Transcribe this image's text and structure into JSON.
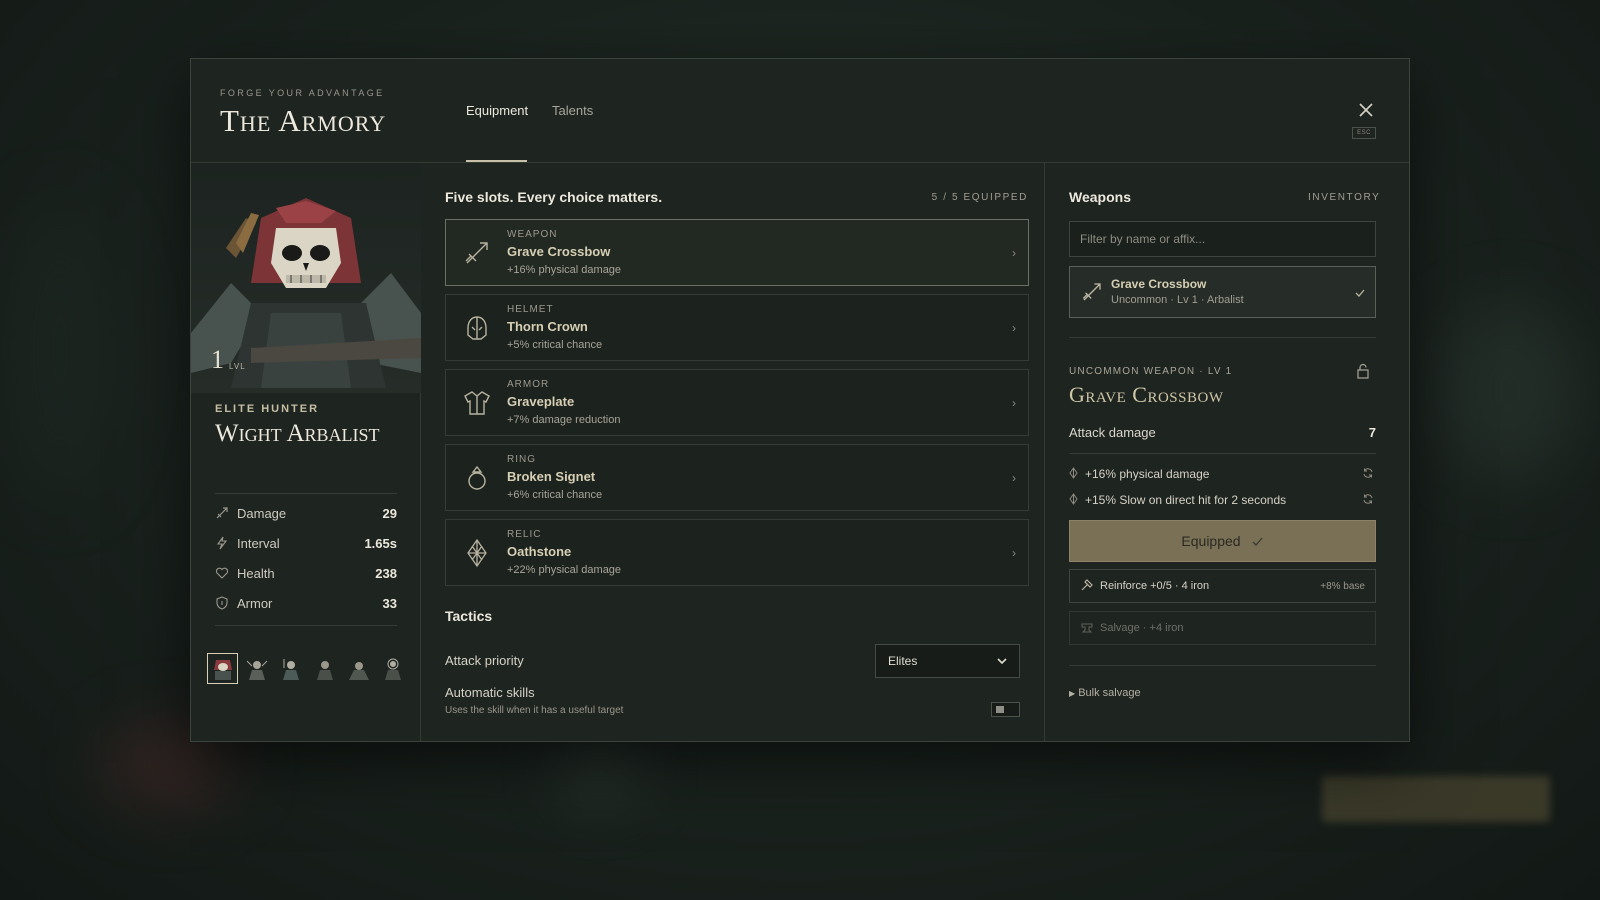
{
  "header": {
    "eyebrow": "FORGE YOUR ADVANTAGE",
    "title": "The Armory",
    "tabs": [
      {
        "label": "Equipment",
        "active": true
      },
      {
        "label": "Talents",
        "active": false
      }
    ],
    "close_hint": "ESC"
  },
  "hero": {
    "level": "1",
    "level_label": "LVL",
    "class": "ELITE HUNTER",
    "name": "Wight Arbalist",
    "stats": [
      {
        "label": "Damage",
        "value": "29",
        "icon": "crossbow-icon"
      },
      {
        "label": "Interval",
        "value": "1.65s",
        "icon": "lightning-icon"
      },
      {
        "label": "Health",
        "value": "238",
        "icon": "heart-icon"
      },
      {
        "label": "Armor",
        "value": "33",
        "icon": "shield-icon"
      }
    ],
    "roster_count": 6
  },
  "equipment": {
    "heading": "Five slots. Every choice matters.",
    "count": "5 / 5 EQUIPPED",
    "slots": [
      {
        "type": "Weapon",
        "name": "Grave Crossbow",
        "affix": "+16% physical damage",
        "icon": "crossbow-icon"
      },
      {
        "type": "Helmet",
        "name": "Thorn Crown",
        "affix": "+5% critical chance",
        "icon": "helmet-icon"
      },
      {
        "type": "Armor",
        "name": "Graveplate",
        "affix": "+7% damage reduction",
        "icon": "chestplate-icon"
      },
      {
        "type": "Ring",
        "name": "Broken Signet",
        "affix": "+6% critical chance",
        "icon": "ring-icon"
      },
      {
        "type": "Relic",
        "name": "Oathstone",
        "affix": "+22% physical damage",
        "icon": "relic-icon"
      }
    ]
  },
  "tactics": {
    "heading": "Tactics",
    "priority_label": "Attack priority",
    "priority_value": "Elites",
    "auto_label": "Automatic skills",
    "auto_desc": "Uses the skill when it has a useful target",
    "auto_enabled": false
  },
  "inventory": {
    "heading": "Weapons",
    "tag": "INVENTORY",
    "filter_placeholder": "Filter by name or affix...",
    "items": [
      {
        "name": "Grave Crossbow",
        "meta": "Uncommon · Lv 1 · Arbalist",
        "equipped": true
      }
    ]
  },
  "detail": {
    "eyebrow": "UNCOMMON WEAPON · LV 1",
    "title": "Grave Crossbow",
    "attack_label": "Attack damage",
    "attack_value": "7",
    "affixes": [
      "+16% physical damage",
      "+15% Slow on direct hit for 2 seconds"
    ],
    "equipped_label": "Equipped",
    "reinforce_label": "Reinforce +0/5 · 4 iron",
    "reinforce_bonus": "+8% base",
    "salvage_label": "Salvage · +4 iron",
    "bulk_label": "Bulk salvage"
  },
  "colors": {
    "accent_gold": "#7a7056",
    "panel": "#1e2420",
    "hood": "#8a3a3c"
  }
}
